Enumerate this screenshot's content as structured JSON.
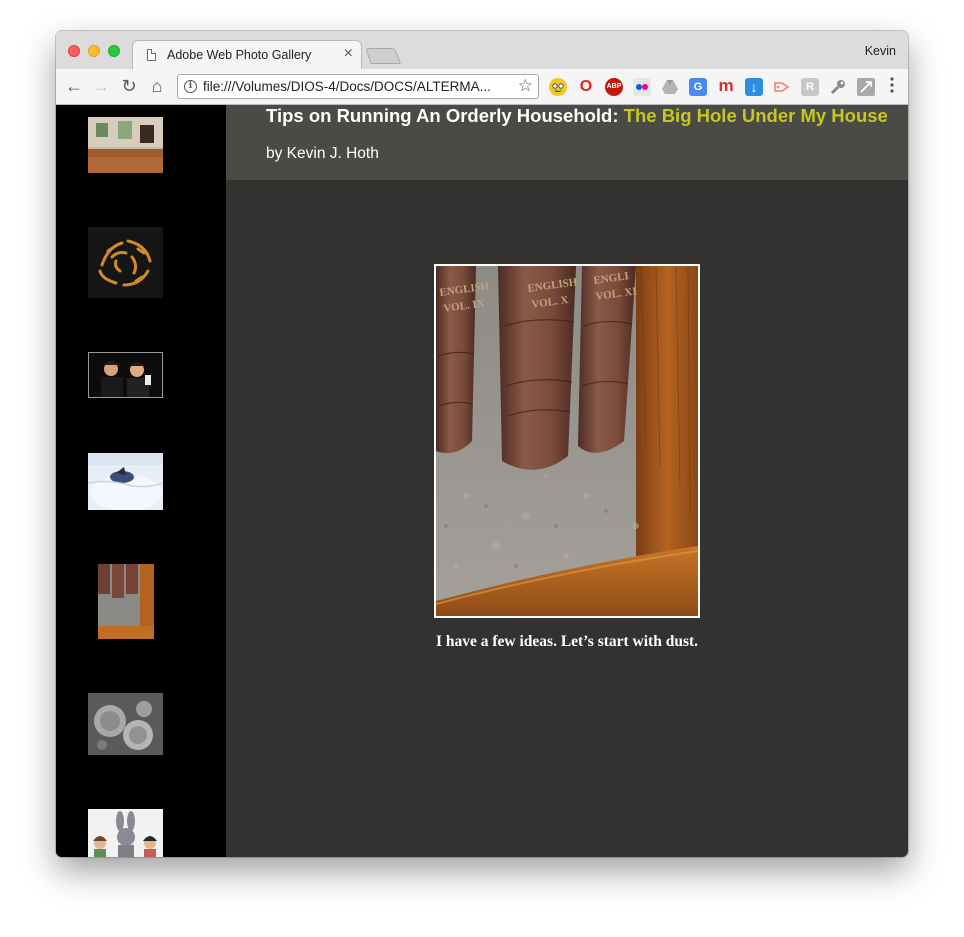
{
  "browser": {
    "tab_title": "Adobe Web Photo Gallery",
    "tab_close": "×",
    "profile_name": "Kevin",
    "url": "file:///Volumes/DIOS-4/Docs/DOCS/ALTERMA...",
    "back_glyph": "←",
    "forward_glyph": "→",
    "reload_glyph": "↻",
    "home_glyph": "⌂",
    "info_glyph": "i",
    "star_glyph": "☆",
    "menu_glyph": "⋮",
    "extensions": [
      {
        "name": "emoji-extension-icon",
        "label": ""
      },
      {
        "name": "opera-extension-icon",
        "label": "O"
      },
      {
        "name": "adblock-plus-icon",
        "label": "ABP"
      },
      {
        "name": "flickr-extension-icon",
        "label": "••"
      },
      {
        "name": "google-drive-extension-icon",
        "label": ""
      },
      {
        "name": "google-translate-extension-icon",
        "label": "G"
      },
      {
        "name": "m-extension-icon",
        "label": "m"
      },
      {
        "name": "download-extension-icon",
        "label": "↓"
      },
      {
        "name": "cast-extension-icon",
        "label": ""
      },
      {
        "name": "readability-extension-icon",
        "label": "R"
      },
      {
        "name": "tools-extension-icon",
        "label": ""
      },
      {
        "name": "shortcut-extension-icon",
        "label": ""
      }
    ]
  },
  "page": {
    "title_main": "Tips on Running An Orderly Household: ",
    "title_accent": "The Big Hole Under My House",
    "byline": "by Kevin J. Hoth",
    "caption": "I have a few ideas. Let’s start with dust.",
    "colors": {
      "accent": "#c9c521",
      "header_bg": "#4a4b44",
      "content_bg": "#333230",
      "sidebar_bg": "#000000"
    }
  },
  "thumbnails": [
    {
      "name": "thumbnail-empty-room"
    },
    {
      "name": "thumbnail-orange-pattern"
    },
    {
      "name": "thumbnail-two-people"
    },
    {
      "name": "thumbnail-igloo-snow"
    },
    {
      "name": "thumbnail-books-dust"
    },
    {
      "name": "thumbnail-dust-microscope"
    },
    {
      "name": "thumbnail-bunny-cartoon"
    }
  ]
}
